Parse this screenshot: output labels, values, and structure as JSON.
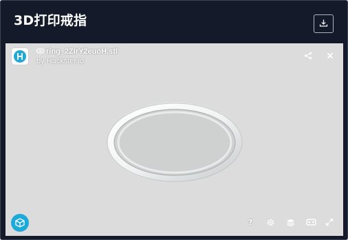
{
  "header": {
    "title": "3D打印戒指"
  },
  "viewer": {
    "model_name": "ring_2ZIrY2euoH.stl",
    "byline": "by Hackster.io",
    "help_label": "?"
  },
  "icons": {
    "download": "download-icon",
    "logo": "hackster-logo",
    "eye": "eye-icon",
    "share": "share-icon",
    "close": "close-icon",
    "viewer_logo": "cube-logo-icon",
    "settings": "gear-icon",
    "layers": "layers-icon",
    "vr": "vr-headset-icon",
    "fullscreen": "fullscreen-icon"
  },
  "colors": {
    "header_bg": "#141a2a",
    "viewer_bg": "#dcdcdc",
    "accent": "#1caad9"
  }
}
